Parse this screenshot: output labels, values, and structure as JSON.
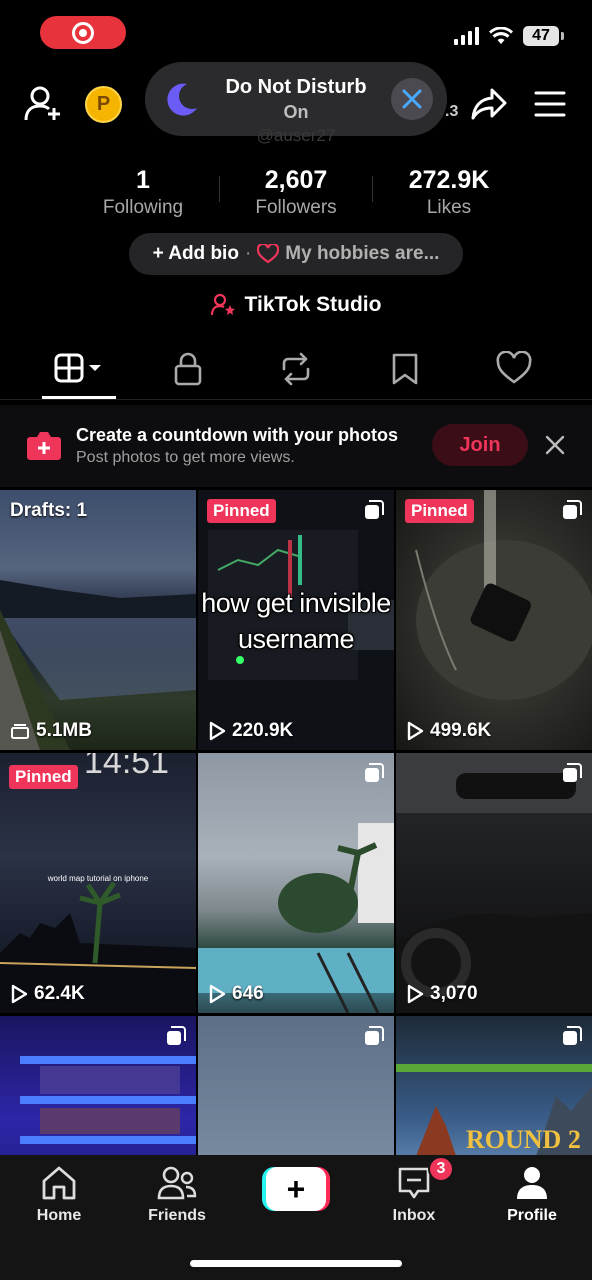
{
  "status_bar": {
    "battery": "47"
  },
  "dnd": {
    "title": "Do Not Disturb",
    "subtitle": "On",
    "partial_text": ".3"
  },
  "profile": {
    "handle_partial": "@auser27"
  },
  "stats": [
    {
      "value": "1",
      "label": "Following"
    },
    {
      "value": "2,607",
      "label": "Followers"
    },
    {
      "value": "272.9K",
      "label": "Likes"
    }
  ],
  "bio": {
    "add_label": "+ Add bio",
    "separator": "·",
    "hobbies": "My hobbies are..."
  },
  "studio": {
    "label": "TikTok Studio"
  },
  "banner": {
    "title": "Create a countdown with your photos",
    "subtitle": "Post photos to get more views.",
    "join_label": "Join"
  },
  "grid": {
    "caption": [
      "how get invisible",
      "username"
    ],
    "items": [
      {
        "drafts": "Drafts: 1",
        "size": "5.1MB"
      },
      {
        "pinned": "Pinned",
        "views": "220.9K"
      },
      {
        "pinned": "Pinned",
        "views": "499.6K"
      },
      {
        "pinned": "Pinned",
        "views": "62.4K",
        "overlay_time": "14:51",
        "overlay_text": "world map tutorial on iphone"
      },
      {
        "views": "646"
      },
      {
        "views": "3,070"
      },
      {
        "views": ""
      },
      {
        "views": ""
      },
      {
        "views": "",
        "overlay_text": "ROUND 2"
      }
    ]
  },
  "bottom_nav": {
    "home": "Home",
    "friends": "Friends",
    "inbox": "Inbox",
    "inbox_badge": "3",
    "profile": "Profile"
  },
  "colors": {
    "accent": "#f0355a",
    "cyan": "#25f4ee",
    "bg": "#000000"
  }
}
